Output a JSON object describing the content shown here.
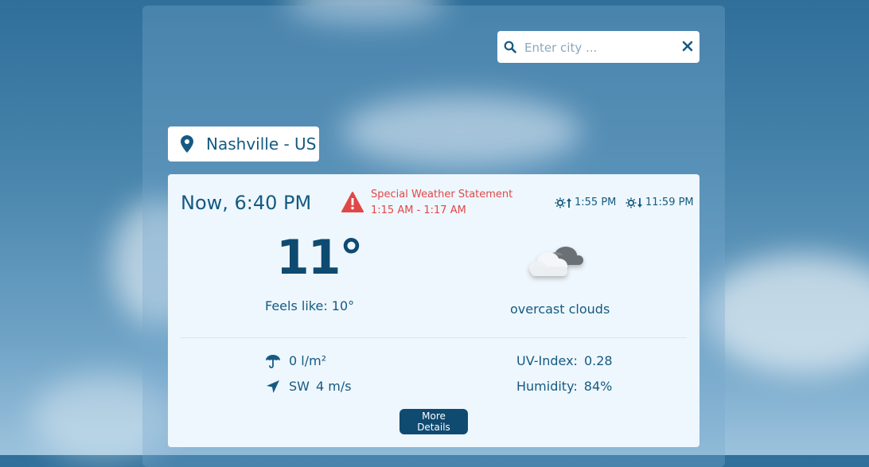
{
  "search": {
    "placeholder": "Enter city ...",
    "value": ""
  },
  "location": {
    "label": "Nashville - US"
  },
  "current": {
    "time_label": "Now, 6:40 PM",
    "temperature": "11°",
    "feels_like": "Feels like: 10°",
    "description": "overcast clouds",
    "weather_icon": "overcast-clouds-icon"
  },
  "alert": {
    "title": "Special Weather Statement",
    "time_range": "1:15 AM - 1:17 AM",
    "color": "#e04848"
  },
  "sun": {
    "sunrise": "1:55 PM",
    "sunset": "11:59 PM"
  },
  "details": {
    "precipitation": "0 l/m²",
    "wind_direction": "SW",
    "wind_speed": "4 m/s",
    "uv_label": "UV-Index:",
    "uv_value": "0.28",
    "humidity_label": "Humidity:",
    "humidity_value": "84%"
  },
  "buttons": {
    "more_details": "More Details"
  },
  "colors": {
    "primary": "#155a82",
    "button": "#0f4a70",
    "card_bg": "#eef7fd"
  }
}
